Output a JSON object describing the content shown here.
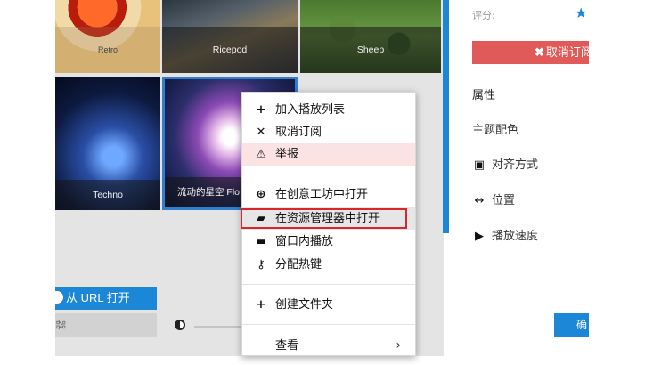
{
  "tiles": [
    {
      "label": "Retro"
    },
    {
      "label": "Ricepod"
    },
    {
      "label": "Sheep"
    },
    {
      "label": "Techno"
    },
    {
      "label": "流动的星空 Flo"
    }
  ],
  "left_buttons": {
    "url_open": "从 URL 打开",
    "gray_partial": "器"
  },
  "right_panel": {
    "score_label": "评分:",
    "star": "★",
    "unsubscribe": "取消订阅",
    "properties_title": "属性",
    "items": [
      {
        "label": "主题配色"
      },
      {
        "label": "对齐方式"
      },
      {
        "label": "位置"
      },
      {
        "label": "播放速度"
      }
    ],
    "bottom_button_partial": "确"
  },
  "context_menu": {
    "items": [
      {
        "label": "加入播放列表",
        "icon": "plus-icon"
      },
      {
        "label": "取消订阅",
        "icon": "close-icon"
      },
      {
        "label": "举报",
        "icon": "warning-icon"
      },
      {
        "label": "在创意工坊中打开",
        "icon": "steam-icon"
      },
      {
        "label": "在资源管理器中打开",
        "icon": "folder-open-icon"
      },
      {
        "label": "窗口内播放",
        "icon": "window-icon"
      },
      {
        "label": "分配热键",
        "icon": "key-icon"
      },
      {
        "label": "创建文件夹",
        "icon": "plus-icon"
      },
      {
        "label": "查看",
        "icon": "chevron-right-icon"
      }
    ]
  },
  "colors": {
    "accent": "#1b87d6",
    "danger": "#e05a5a",
    "highlight_outline": "#d8262b"
  }
}
